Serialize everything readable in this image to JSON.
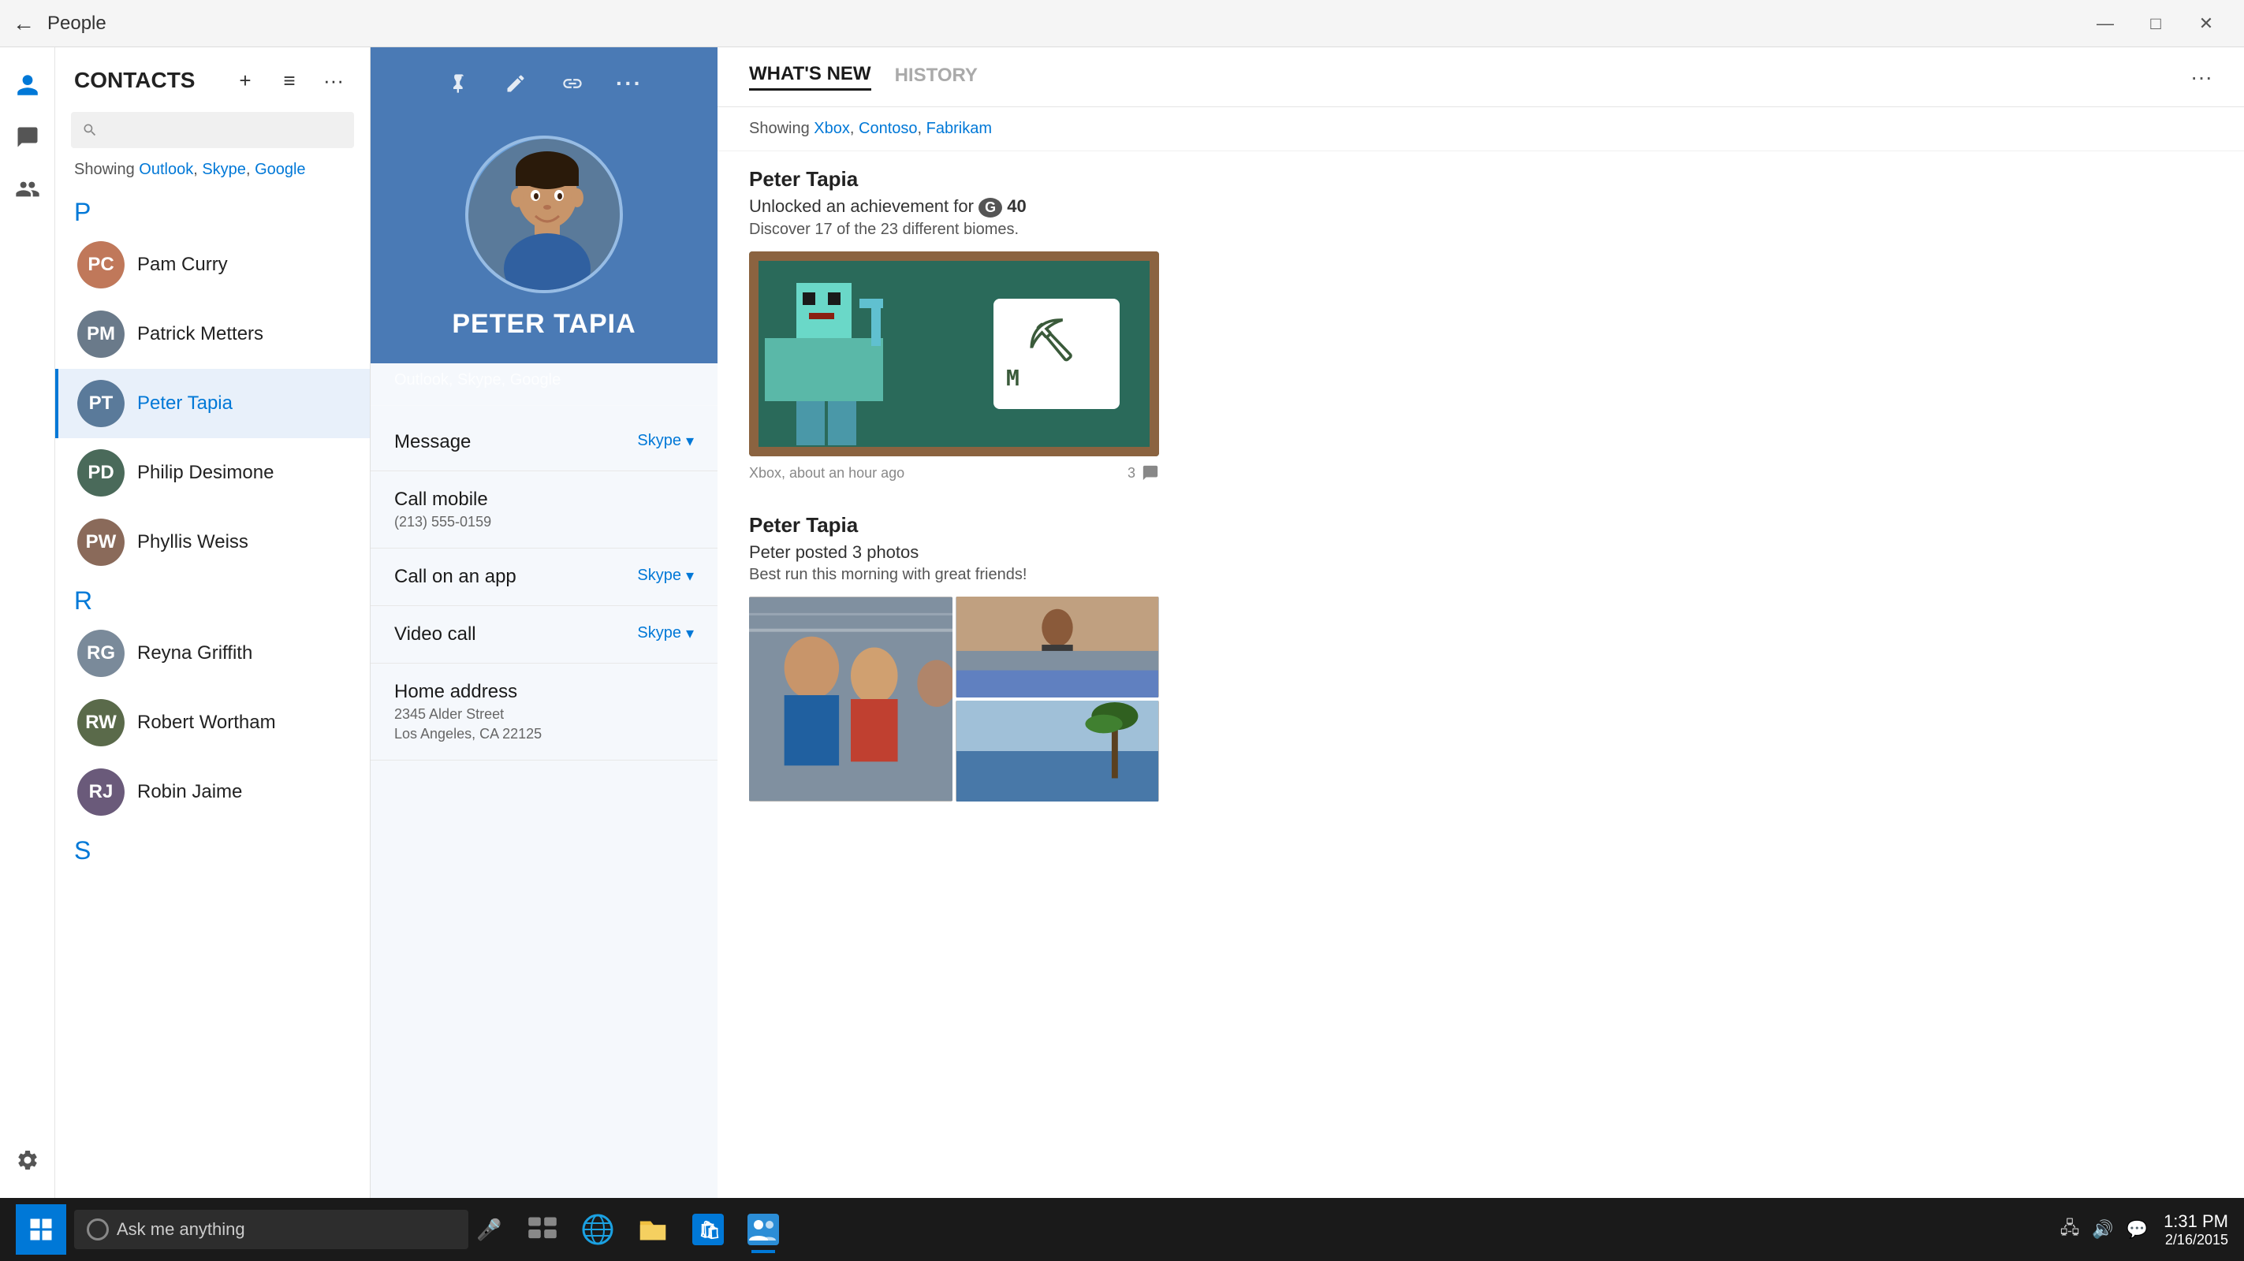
{
  "window": {
    "title": "People",
    "back_icon": "←",
    "minimize_icon": "—",
    "maximize_icon": "□",
    "close_icon": "✕"
  },
  "contacts_panel": {
    "title": "CONTACTS",
    "search_placeholder": "",
    "showing_label": "Showing",
    "showing_sources": [
      "Outlook",
      "Skype",
      "Google"
    ],
    "add_btn": "+",
    "list_btn": "≡",
    "more_btn": "···",
    "contacts": [
      {
        "letter": "P",
        "items": [
          {
            "name": "Pam Curry",
            "initials": "PC",
            "color": "#c0785a"
          },
          {
            "name": "Patrick Metters",
            "initials": "PM",
            "color": "#6a7a8a"
          },
          {
            "name": "Peter Tapia",
            "initials": "PT",
            "color": "#5a7a9a",
            "active": true
          },
          {
            "name": "Philip Desimone",
            "initials": "PD",
            "color": "#4a6a5a"
          },
          {
            "name": "Phyllis Weiss",
            "initials": "PW",
            "color": "#8a6a5a"
          }
        ]
      },
      {
        "letter": "R",
        "items": [
          {
            "name": "Reyna Griffith",
            "initials": "RG",
            "color": "#7a8a9a"
          },
          {
            "name": "Robert Wortham",
            "initials": "RW",
            "color": "#5a6a4a"
          },
          {
            "name": "Robin Jaime",
            "initials": "RJ",
            "color": "#6a5a7a"
          }
        ]
      },
      {
        "letter": "S",
        "items": []
      }
    ]
  },
  "detail": {
    "name": "PETER TAPIA",
    "sources": "Outlook, Skype, Google",
    "pin_icon": "📌",
    "edit_icon": "✏",
    "link_icon": "🔗",
    "more_icon": "···",
    "actions": [
      {
        "label": "Message",
        "right": "Skype ▾"
      },
      {
        "label": "Call mobile",
        "sub": "(213) 555-0159",
        "right": ""
      },
      {
        "label": "Call on an app",
        "right": "Skype ▾"
      },
      {
        "label": "Video call",
        "right": "Skype ▾"
      },
      {
        "label": "Home address",
        "sub1": "2345 Alder Street",
        "sub2": "Los Angeles, CA 22125",
        "right": ""
      }
    ]
  },
  "whats_new": {
    "tab_active": "WHAT'S NEW",
    "tab_inactive": "HISTORY",
    "more_icon": "···",
    "showing_label": "Showing",
    "showing_sources": [
      "Xbox",
      "Contoso",
      "Fabrikam"
    ],
    "items": [
      {
        "person": "Peter Tapia",
        "desc": "Unlocked an achievement for",
        "badge": "G 40",
        "subdesc": "Discover 17 of the 23 different biomes.",
        "type": "minecraft",
        "meta_source": "Xbox, about an hour ago",
        "comments": "3"
      },
      {
        "person": "Peter Tapia",
        "desc": "Peter posted 3 photos",
        "subdesc": "Best run this morning with great friends!",
        "type": "photos"
      }
    ]
  },
  "taskbar": {
    "search_placeholder": "Ask me anything",
    "time": "1:31 PM",
    "date": "2/16/2015"
  },
  "nav": {
    "people_icon": "👤",
    "chat_icon": "💬",
    "group_icon": "👥",
    "gear_icon": "⚙"
  }
}
